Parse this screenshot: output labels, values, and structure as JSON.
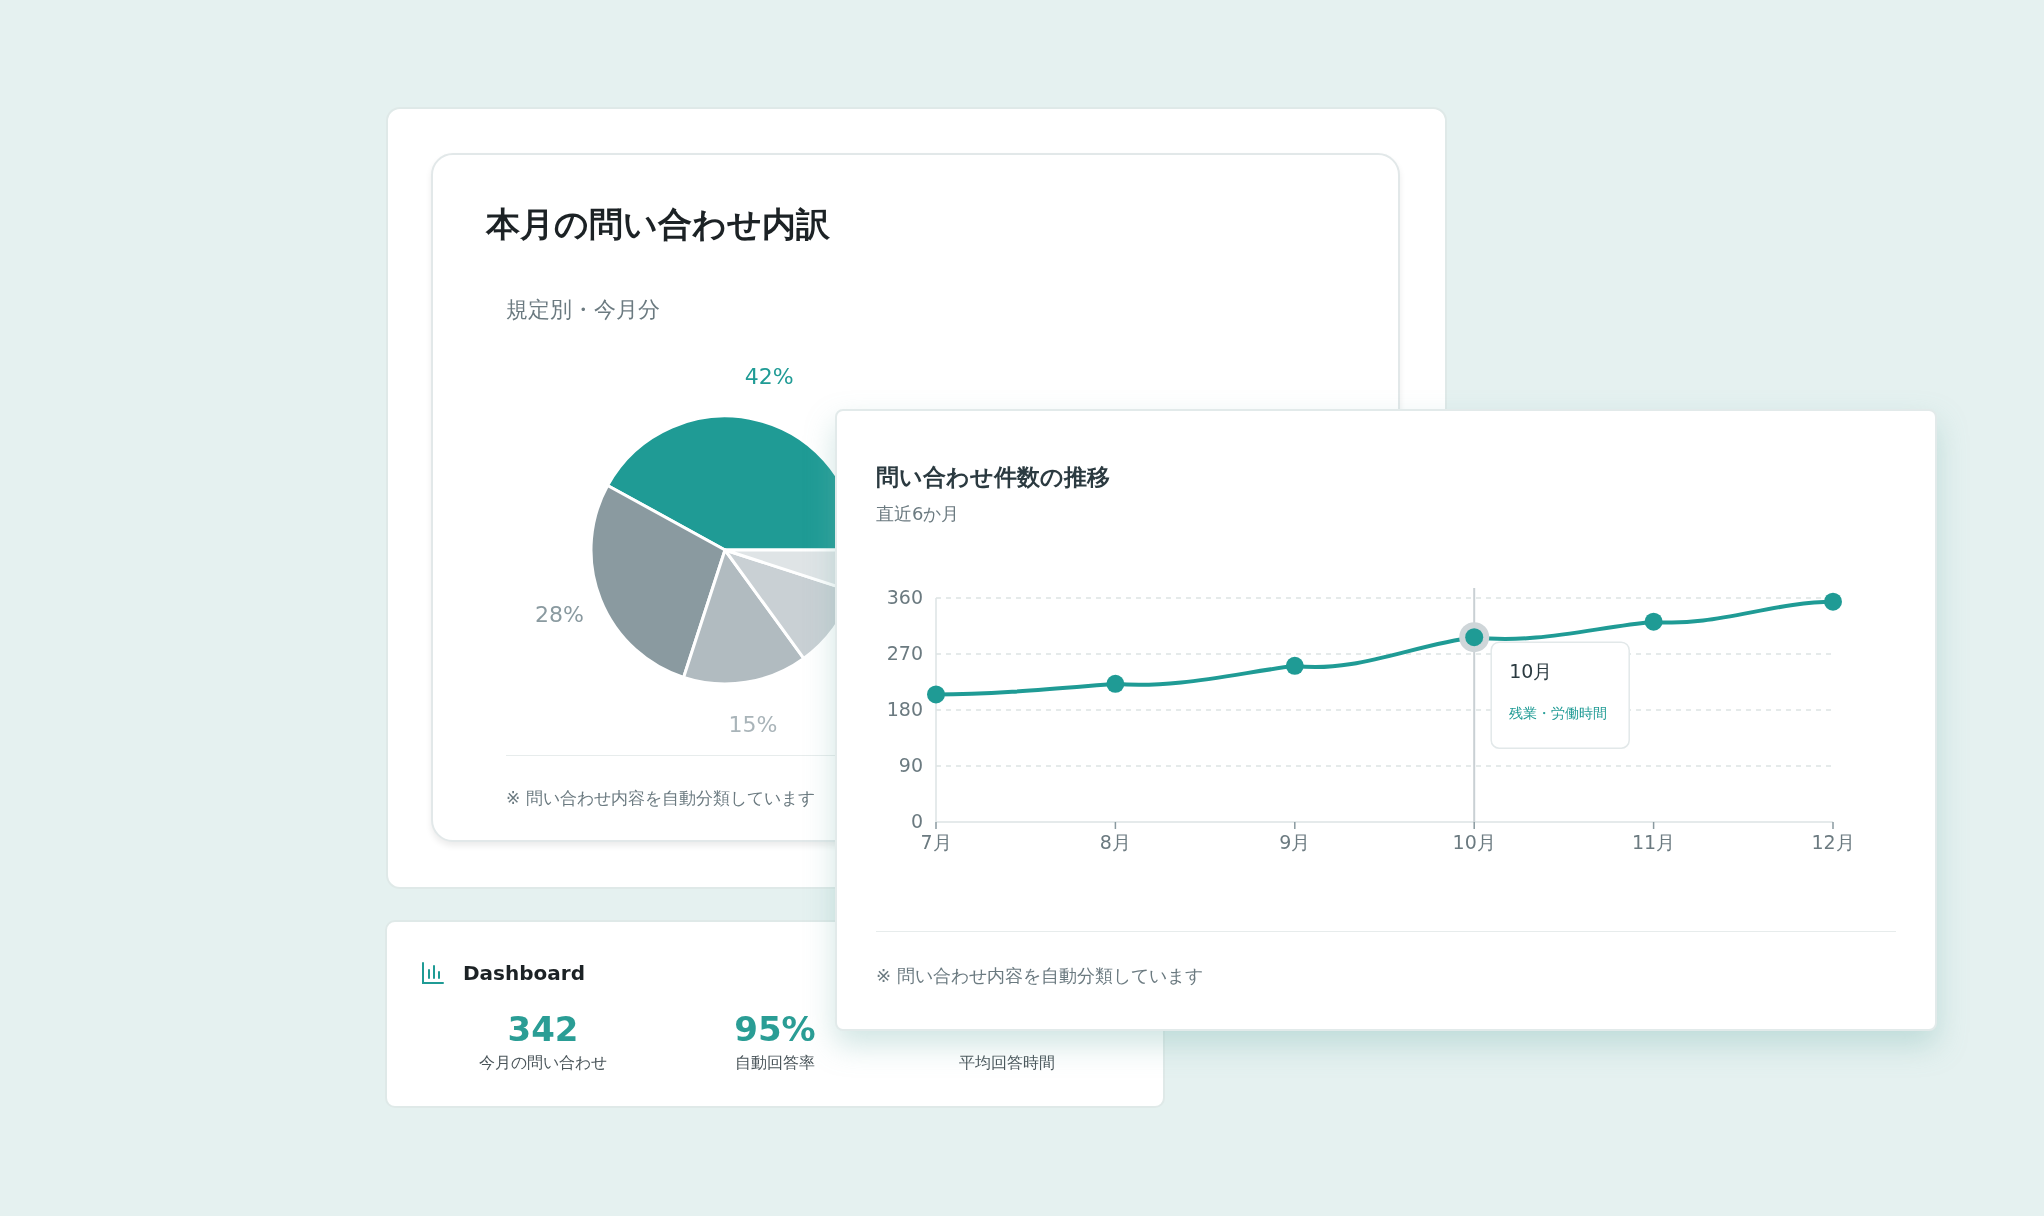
{
  "breakdown_card": {
    "title": "本月の問い合わせ内訳",
    "subtitle": "規定別・今月分",
    "chart_data": {
      "type": "pie",
      "values": [
        42,
        28,
        15,
        10,
        5
      ],
      "value_labels": [
        "42%",
        "28%",
        "15%",
        null,
        null
      ]
    },
    "footnote": "※ 問い合わせ内容を自動分類しています"
  },
  "dashboard": {
    "title": "Dashboard",
    "stats": [
      {
        "value": "342",
        "label": "今月の問い合わせ",
        "kind": "accent"
      },
      {
        "value": "95%",
        "label": "自動回答率",
        "kind": "accent"
      },
      {
        "label": "平均回答時間"
      }
    ]
  },
  "trend_card": {
    "title": "問い合わせ件数の推移",
    "subtitle": "直近6か月",
    "chart_data": {
      "type": "line",
      "categories": [
        "7月",
        "8月",
        "9月",
        "10月",
        "11月",
        "12月"
      ],
      "series": [
        {
          "color": "#1f9b95",
          "marker": true,
          "values": [
            205,
            222,
            251,
            297,
            322,
            354
          ]
        }
      ],
      "grid": true,
      "ref_lines": [
        {
          "axis": "x",
          "value": "10月",
          "color": "#c9d0d4"
        }
      ],
      "ylim": [
        0,
        360
      ],
      "yticks": [
        0,
        90,
        180,
        270,
        360
      ]
    },
    "points": [
      {
        "selected": false
      },
      {
        "selected": false
      },
      {
        "selected": false
      },
      {
        "selected": true
      },
      {
        "selected": false
      },
      {
        "selected": false
      }
    ],
    "tooltip": {
      "title": "10月",
      "text": "残業・労働時間"
    },
    "footnote": "※ 問い合わせ内容を自動分類しています"
  }
}
